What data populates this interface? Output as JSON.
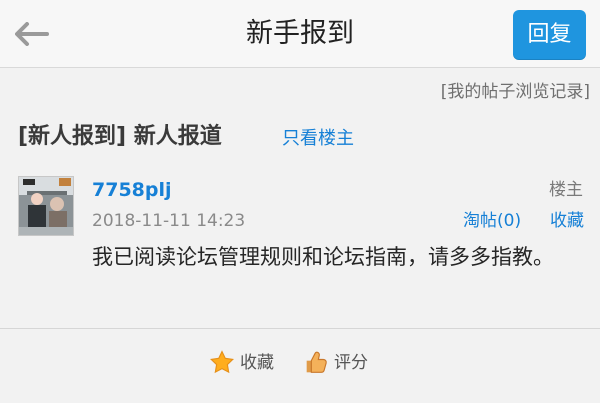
{
  "header": {
    "title": "新手报到",
    "reply_label": "回复"
  },
  "top_link": {
    "history_label": "[我的帖子浏览记录]"
  },
  "thread": {
    "title": "[新人报到] 新人报道",
    "only_op_label": "只看楼主"
  },
  "post": {
    "username": "7758plj",
    "floor_label": "楼主",
    "datetime": "2018-11-11 14:23",
    "taotie_label": "淘帖(0)",
    "collect_label": "收藏",
    "content": "我已阅读论坛管理规则和论坛指南，请多多指教。"
  },
  "actions": {
    "collect_label": "收藏",
    "rate_label": "评分"
  },
  "icons": {
    "back": "back-arrow-icon",
    "collect": "star-icon",
    "rate": "thumbs-up-icon"
  },
  "colors": {
    "accent": "#1680d6",
    "reply_button": "#1f95df",
    "background": "#f2f2f2"
  }
}
